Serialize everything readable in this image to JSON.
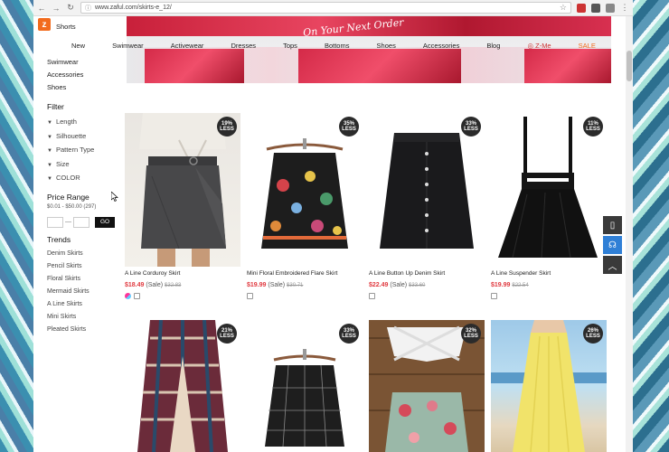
{
  "browser": {
    "url": "www.zaful.com/skirts-e_12/"
  },
  "sidebar": {
    "categories": [
      "Shorts",
      "Swimwear",
      "Accessories",
      "Shoes"
    ],
    "filter_heading": "Filter",
    "filters": [
      "Length",
      "Silhouette",
      "Pattern Type",
      "Size",
      "COLOR"
    ],
    "price_heading": "Price Range",
    "price_range": "$0.01 - $50.00 (297)",
    "go_label": "GO",
    "trends_heading": "Trends",
    "trends": [
      "Denim Skirts",
      "Pencil Skirts",
      "Floral Skirts",
      "Mermaid Skirts",
      "A Line Skirts",
      "Mini Skirts",
      "Pleated Skirts"
    ]
  },
  "topnav": [
    "New",
    "Swimwear",
    "Activewear",
    "Dresses",
    "Tops",
    "Bottoms",
    "Shoes",
    "Accessories",
    "Blog",
    "Z-Me",
    "SALE"
  ],
  "banner": {
    "text": "On Your Next Order"
  },
  "products": [
    {
      "name": "A Line Corduroy Skirt",
      "price": "$18.49",
      "sale": "(Sale)",
      "old": "$32.83",
      "badge_pct": "19%",
      "badge_less": "LESS"
    },
    {
      "name": "Mini Floral Embroidered Flare Skirt",
      "price": "$19.99",
      "sale": "(Sale)",
      "old": "$30.71",
      "badge_pct": "35%",
      "badge_less": "LESS"
    },
    {
      "name": "A Line Button Up Denim Skirt",
      "price": "$22.49",
      "sale": "(Sale)",
      "old": "$33.60",
      "badge_pct": "33%",
      "badge_less": "LESS"
    },
    {
      "name": "A Line Suspender Skirt",
      "price": "$19.99",
      "sale": "",
      "old": "$22.54",
      "badge_pct": "11%",
      "badge_less": "LESS"
    },
    {
      "name": "",
      "price": "",
      "sale": "",
      "old": "",
      "badge_pct": "21%",
      "badge_less": "LESS"
    },
    {
      "name": "",
      "price": "",
      "sale": "",
      "old": "",
      "badge_pct": "33%",
      "badge_less": "LESS"
    },
    {
      "name": "",
      "price": "",
      "sale": "",
      "old": "",
      "badge_pct": "32%",
      "badge_less": "LESS"
    },
    {
      "name": "",
      "price": "",
      "sale": "",
      "old": "",
      "badge_pct": "26%",
      "badge_less": "LESS"
    }
  ],
  "colors": {
    "accent": "#f26b1d",
    "price": "#e0383e",
    "badge": "#2b2b2b",
    "sticky_blue": "#2f7fd6"
  }
}
